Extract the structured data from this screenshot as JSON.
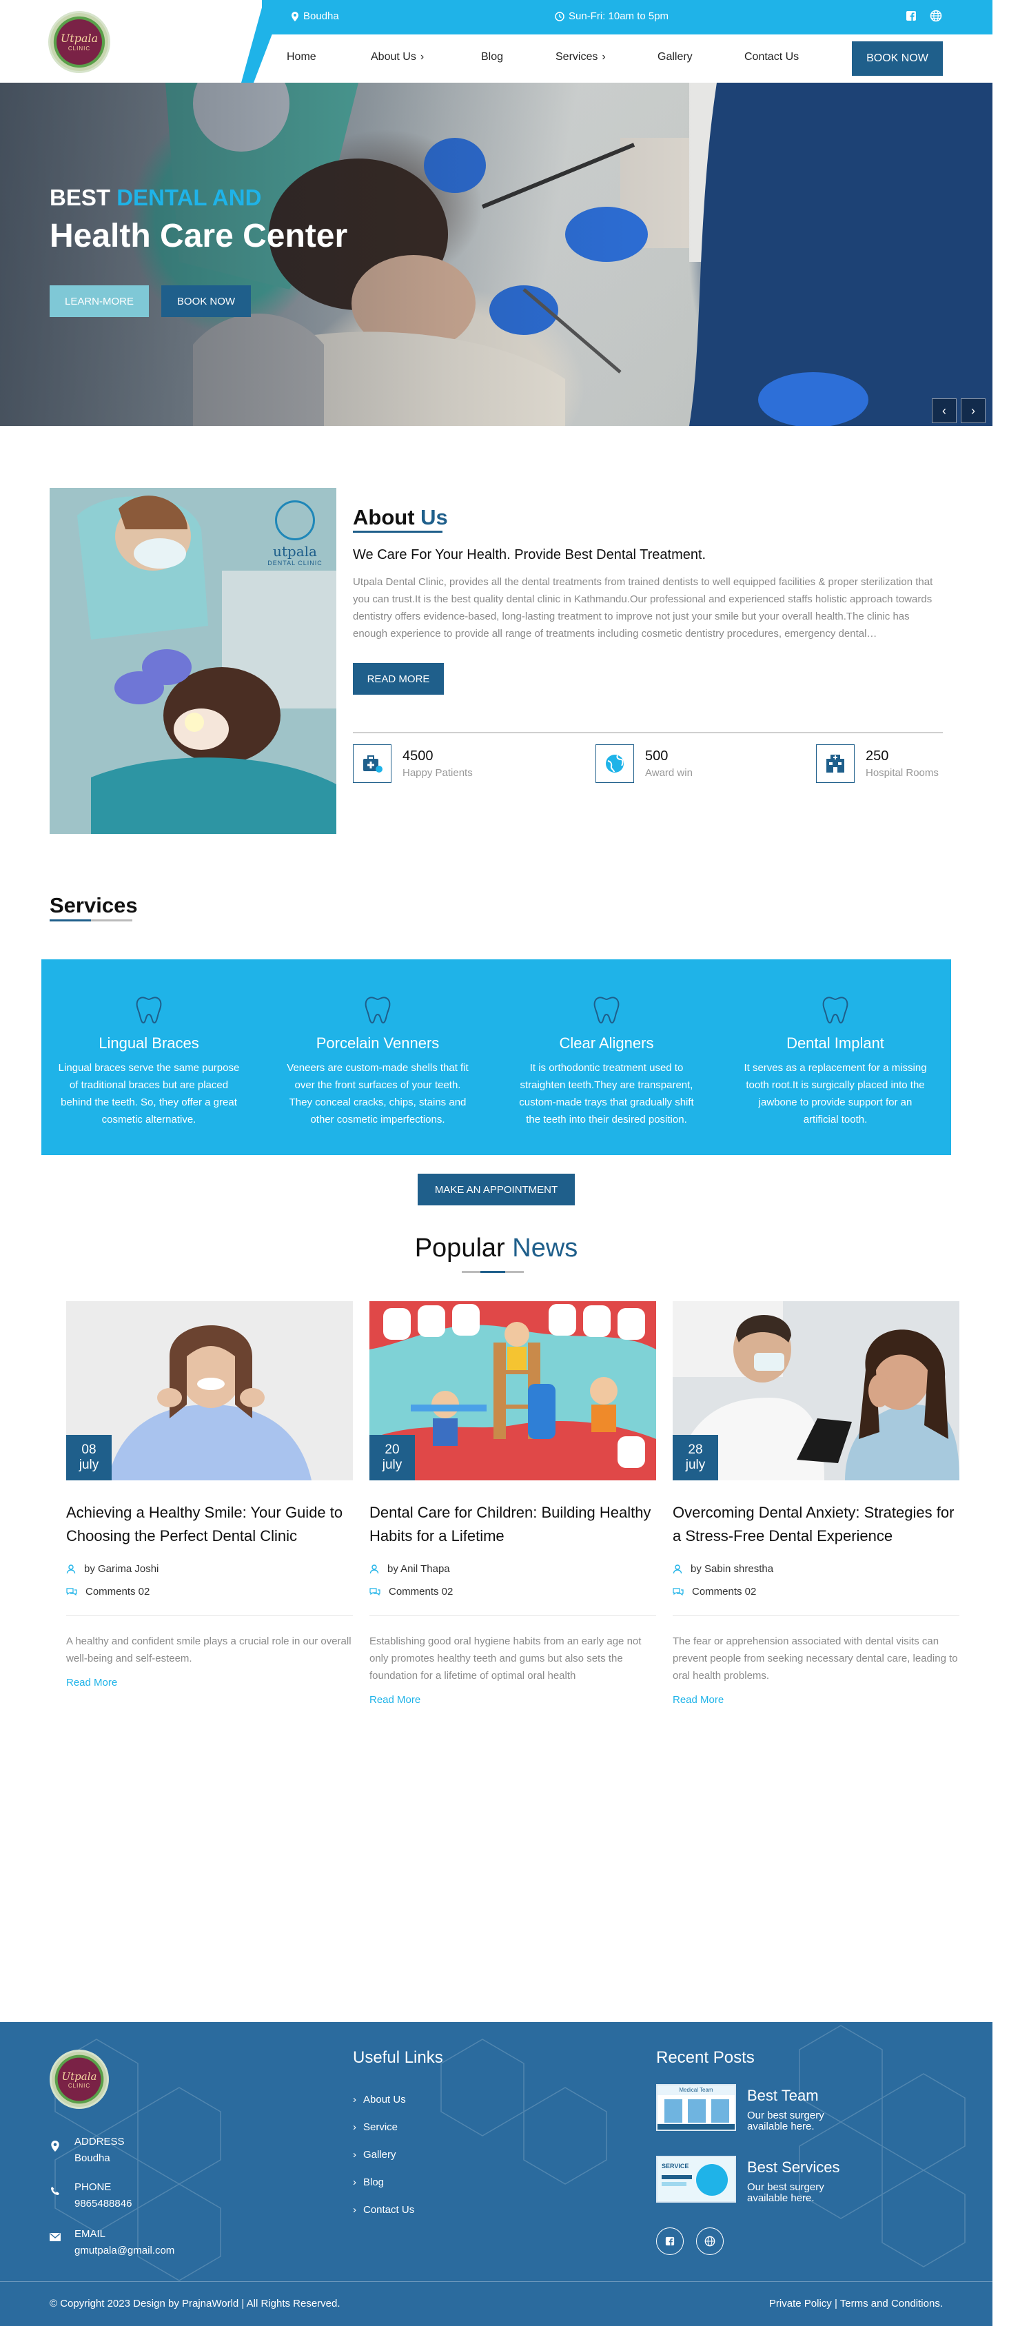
{
  "header": {
    "logo_text": "Utpala",
    "logo_sub": "CLINIC",
    "location": "Boudha",
    "hours": "Sun-Fri: 10am to 5pm",
    "nav": [
      {
        "label": "Home",
        "has_caret": false
      },
      {
        "label": "About Us",
        "has_caret": true
      },
      {
        "label": "Blog",
        "has_caret": false
      },
      {
        "label": "Services",
        "has_caret": true
      },
      {
        "label": "Gallery",
        "has_caret": false
      },
      {
        "label": "Contact Us",
        "has_caret": false
      }
    ],
    "book_now": "BOOK NOW"
  },
  "hero": {
    "line1_plain": "BEST ",
    "line1_accent": "DENTAL AND",
    "line2": "Health Care Center",
    "learn_more": "LEARN-MORE",
    "book_now": "BOOK NOW",
    "prev": "‹",
    "next": "›"
  },
  "about": {
    "title_plain": "About ",
    "title_accent": "Us",
    "subtitle": "We Care For Your Health. Provide Best Dental Treatment.",
    "body": "Utpala Dental Clinic, provides all the dental treatments from trained dentists to well equipped facilities & proper sterilization that you can trust.It is the best quality dental clinic in Kathmandu.Our professional and experienced staffs holistic approach towards dentistry offers evidence-based, long-lasting treatment to improve not just your smile but your overall health.The clinic has enough experience to provide all range of treatments including cosmetic dentistry procedures, emergency dental…",
    "read_more": "READ MORE",
    "image_mark": "utpala",
    "image_mark_sub": "DENTAL CLINIC",
    "stats": [
      {
        "value": "4500",
        "label": "Happy Patients",
        "icon": "first-aid-kit-icon"
      },
      {
        "value": "500",
        "label": "Award win",
        "icon": "globe-icon"
      },
      {
        "value": "250",
        "label": "Hospital Rooms",
        "icon": "hospital-icon"
      }
    ]
  },
  "services": {
    "title": "Services",
    "items": [
      {
        "title": "Lingual Braces",
        "text": "Lingual braces serve the same purpose of traditional braces but are placed behind the teeth. So, they offer a great cosmetic alternative."
      },
      {
        "title": "Porcelain Venners",
        "text": "Veneers are custom-made shells that fit over the front surfaces of your teeth. They conceal cracks, chips, stains and other cosmetic imperfections."
      },
      {
        "title": "Clear Aligners",
        "text": "It is orthodontic treatment used to straighten teeth.They are transparent, custom-made trays that gradually shift the teeth into their desired position."
      },
      {
        "title": "Dental Implant",
        "text": "It serves as a replacement for a missing tooth root.It is surgically placed into the jawbone to provide support for an artificial tooth."
      }
    ],
    "appointment": "MAKE AN APPOINTMENT"
  },
  "news": {
    "title_plain": "Popular ",
    "title_accent": "News",
    "cards": [
      {
        "day": "08",
        "month": "july",
        "title": "Achieving a Healthy Smile: Your Guide to Choosing the Perfect Dental Clinic",
        "author": "by Garima Joshi",
        "comments": "Comments 02",
        "text": "A healthy and confident smile plays a crucial role in our overall well-being and self-esteem.",
        "link": "Read More"
      },
      {
        "day": "20",
        "month": "july",
        "title": "Dental Care for Children: Building Healthy Habits for a Lifetime",
        "author": "by Anil Thapa",
        "comments": "Comments 02",
        "text": "Establishing good oral hygiene habits from an early age not only promotes healthy teeth and gums but also sets the foundation for a lifetime of optimal oral health",
        "link": "Read More"
      },
      {
        "day": "28",
        "month": "july",
        "title": "Overcoming Dental Anxiety: Strategies for a Stress-Free Dental Experience",
        "author": "by Sabin shrestha",
        "comments": "Comments 02",
        "text": "The fear or apprehension associated with dental visits can prevent people from seeking necessary dental care, leading to oral health problems.",
        "link": "Read More"
      }
    ]
  },
  "footer": {
    "logo_text": "Utpala",
    "logo_sub": "CLINIC",
    "contacts": [
      {
        "label": "ADDRESS",
        "value": "Boudha",
        "icon": "map-pin-icon"
      },
      {
        "label": "PHONE",
        "value": "9865488846",
        "icon": "phone-icon"
      },
      {
        "label": "EMAIL",
        "value": "gmutpala@gmail.com",
        "icon": "envelope-icon"
      }
    ],
    "useful_links_title": "Useful Links",
    "useful_links": [
      "About Us",
      "Service",
      "Gallery",
      "Blog",
      "Contact Us"
    ],
    "recent_posts_title": "Recent Posts",
    "posts": [
      {
        "title": "Best Team",
        "text": "Our best surgery available here.",
        "thumb_label": "Medical Team"
      },
      {
        "title": "Best Services",
        "text": "Our best surgery available here.",
        "thumb_label": "SERVICE"
      }
    ],
    "copyright": "© Copyright 2023 Design by PrajnaWorld | All Rights Reserved.",
    "legal": "Private Policy | Terms and Conditions."
  },
  "colors": {
    "primary": "#1f5f8b",
    "accent": "#1fb3e8",
    "footer": "#2b6b9e"
  }
}
